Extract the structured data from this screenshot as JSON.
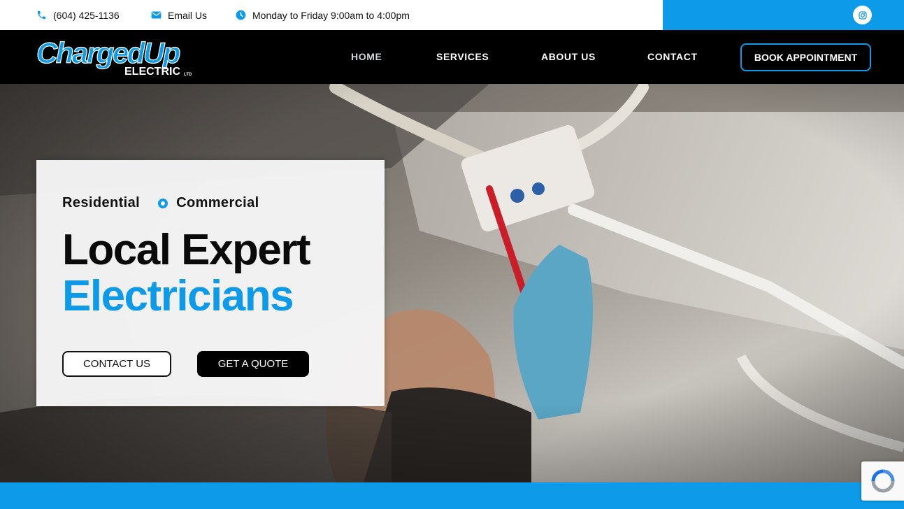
{
  "topbar": {
    "phone": "(604) 425-1136",
    "email_label": "Email Us",
    "hours": "Monday to Friday 9:00am to 4:00pm",
    "social_icon": "instagram-icon"
  },
  "brand": {
    "name_top": "Charged",
    "name_top2": "Up",
    "name_bottom": "ELECTRIC",
    "suffix": "LTD"
  },
  "nav": {
    "items": [
      {
        "label": "HOME",
        "active": true
      },
      {
        "label": "SERVICES",
        "active": false
      },
      {
        "label": "ABOUT US",
        "active": false
      },
      {
        "label": "CONTACT",
        "active": false
      }
    ],
    "cta": "BOOK APPOINTMENT"
  },
  "hero": {
    "tag1": "Residential",
    "tag2": "Commercial",
    "headline_line1": "Local Expert",
    "headline_line2": "Electricians",
    "primary_button": "CONTACT US",
    "secondary_button": "GET A QUOTE"
  },
  "colors": {
    "accent": "#0d9ae8",
    "dark": "#000000",
    "light": "#ffffff"
  }
}
